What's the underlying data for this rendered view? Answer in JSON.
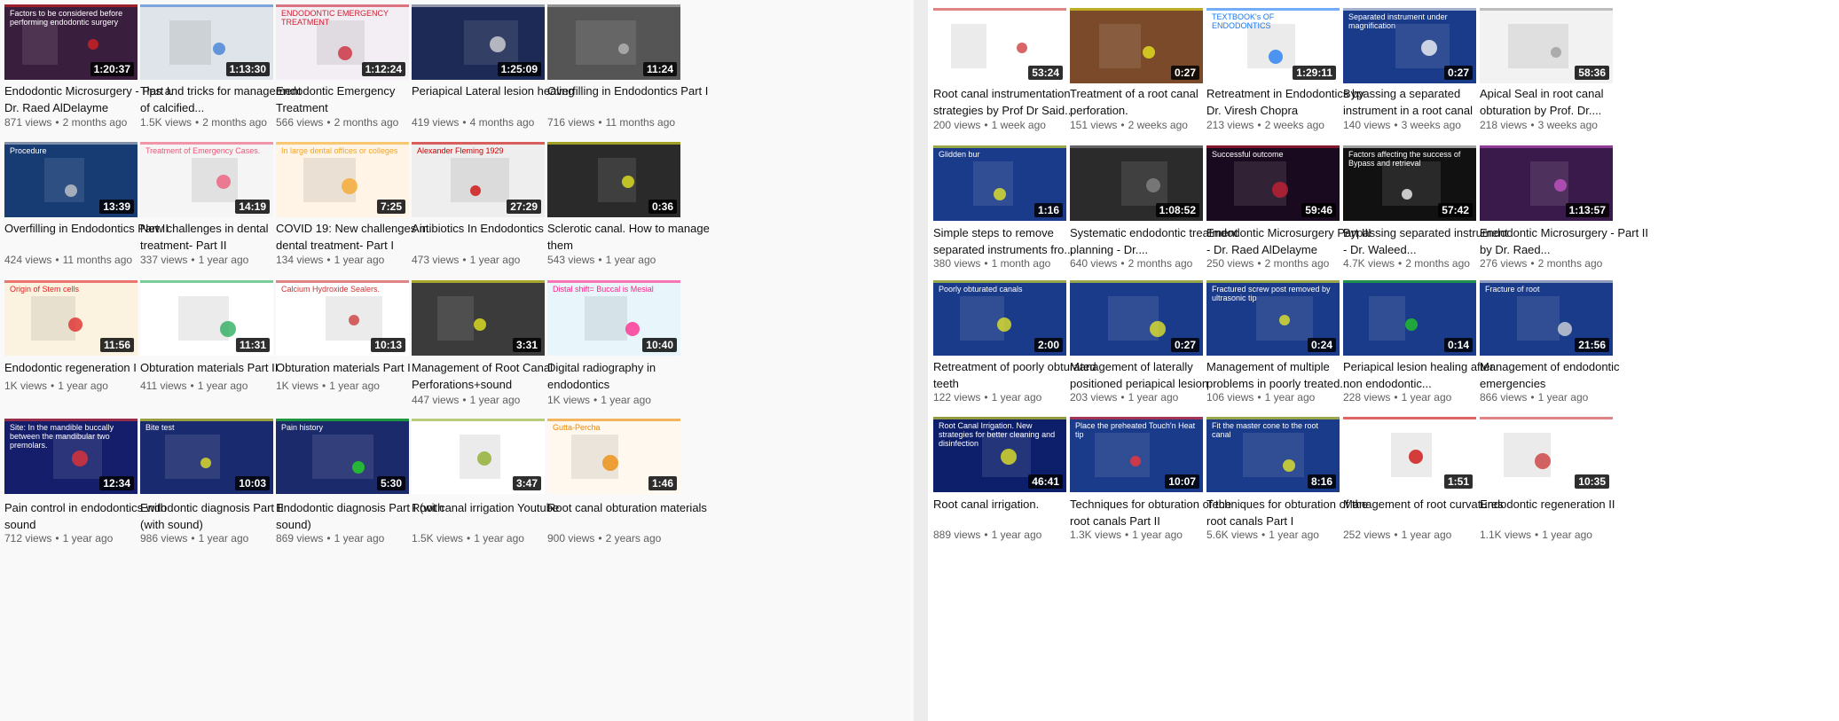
{
  "left": {
    "videos": [
      {
        "title": "Endodontic Microsurgery - Part I. Dr. Raed AlDelayme",
        "views": "871 views",
        "age": "2 months ago",
        "duration": "1:20:37",
        "bg": "#3a1e3e",
        "accent": "#d22",
        "thumb_text": "Factors to be considered before performing endodontic surgery"
      },
      {
        "title": "Tips and tricks for management of calcified...",
        "views": "1.5K views",
        "age": "2 months ago",
        "duration": "1:13:30",
        "bg": "#dfe4ea",
        "accent": "#3a7bd5",
        "thumb_text": ""
      },
      {
        "title": "Endodontic Emergency Treatment",
        "views": "566 views",
        "age": "2 months ago",
        "duration": "1:12:24",
        "bg": "#f3eef3",
        "accent": "#c23",
        "thumb_text": "ENDODONTIC EMERGENCY TREATMENT"
      },
      {
        "title": "Periapical Lateral lesion healing",
        "views": "419 views",
        "age": "4 months ago",
        "duration": "1:25:09",
        "bg": "#1d2a55",
        "accent": "#ddd",
        "thumb_text": ""
      },
      {
        "title": "Overfilling in Endodontics Part I",
        "views": "716 views",
        "age": "11 months ago",
        "duration": "11:24",
        "bg": "#555",
        "accent": "#bbb",
        "thumb_text": ""
      },
      {
        "title": "Overfilling in Endodontics Part II",
        "views": "424 views",
        "age": "11 months ago",
        "duration": "13:39",
        "bg": "#173b73",
        "accent": "#ccc",
        "thumb_text": "Procedure"
      },
      {
        "title": "New challenges in dental treatment- Part II",
        "views": "337 views",
        "age": "1 year ago",
        "duration": "14:19",
        "bg": "#f5f5f5",
        "accent": "#e57",
        "thumb_text": "Treatment of Emergency Cases."
      },
      {
        "title": "COVID 19: New challenges in dental treatment- Part I",
        "views": "134 views",
        "age": "1 year ago",
        "duration": "7:25",
        "bg": "#fff4e6",
        "accent": "#f5a623",
        "thumb_text": "In large dental offices or colleges"
      },
      {
        "title": "Antibiotics In Endodontics",
        "views": "473 views",
        "age": "1 year ago",
        "duration": "27:29",
        "bg": "#eeeeee",
        "accent": "#c00",
        "thumb_text": "Alexander Fleming 1929"
      },
      {
        "title": "Sclerotic canal. How to manage them",
        "views": "543 views",
        "age": "1 year ago",
        "duration": "0:36",
        "bg": "#2a2a2a",
        "accent": "#ee2",
        "thumb_text": ""
      },
      {
        "title": "Endodontic regeneration I",
        "views": "1K views",
        "age": "1 year ago",
        "duration": "11:56",
        "bg": "#fbf3e0",
        "accent": "#d22",
        "thumb_text": "Origin of Stem cells"
      },
      {
        "title": "Obturation materials Part II",
        "views": "411 views",
        "age": "1 year ago",
        "duration": "11:31",
        "bg": "#ffffff",
        "accent": "#2a5",
        "thumb_text": ""
      },
      {
        "title": "Obturation materials Part I",
        "views": "1K views",
        "age": "1 year ago",
        "duration": "10:13",
        "bg": "#ffffff",
        "accent": "#c33",
        "thumb_text": "Calcium Hydroxide Sealers."
      },
      {
        "title": "Management of Root Canal Perforations+sound",
        "views": "447 views",
        "age": "1 year ago",
        "duration": "3:31",
        "bg": "#3b3b3b",
        "accent": "#ee2",
        "thumb_text": ""
      },
      {
        "title": "Digital radiography in endodontics",
        "views": "1K views",
        "age": "1 year ago",
        "duration": "10:40",
        "bg": "#e8f6fb",
        "accent": "#f28",
        "thumb_text": "Distal shift= Buccal is Mesial"
      },
      {
        "title": "Pain control in endodontics with sound",
        "views": "712 views",
        "age": "1 year ago",
        "duration": "12:34",
        "bg": "#151e6b",
        "accent": "#e33",
        "thumb_text": "Site: In the mandible buccally between the mandibular two premolars."
      },
      {
        "title": "Endodontic diagnosis Part II (with sound)",
        "views": "986 views",
        "age": "1 year ago",
        "duration": "10:03",
        "bg": "#1a2a6e",
        "accent": "#ee2",
        "thumb_text": "Bite test"
      },
      {
        "title": "Endodontic diagnosis Part I (with sound)",
        "views": "869 views",
        "age": "1 year ago",
        "duration": "5:30",
        "bg": "#1b2a6b",
        "accent": "#2d2",
        "thumb_text": "Pain history"
      },
      {
        "title": "Root canal irrigation Youtube",
        "views": "1.5K views",
        "age": "1 year ago",
        "duration": "3:47",
        "bg": "#ffffff",
        "accent": "#8a2",
        "thumb_text": ""
      },
      {
        "title": "Root canal obturation materials",
        "views": "900 views",
        "age": "2 years ago",
        "duration": "1:46",
        "bg": "#fff8ee",
        "accent": "#e80",
        "thumb_text": "Gutta-Percha"
      }
    ]
  },
  "right": {
    "videos": [
      {
        "title": "Root canal instrumentation strategies by Prof Dr Said...",
        "views": "200 views",
        "age": "1 week ago",
        "duration": "53:24",
        "bg": "#ffffff",
        "accent": "#c33",
        "thumb_text": ""
      },
      {
        "title": "Treatment of a root canal perforation.",
        "views": "151 views",
        "age": "2 weeks ago",
        "duration": "0:27",
        "bg": "#7a4a2a",
        "accent": "#ee2",
        "thumb_text": ""
      },
      {
        "title": "Retreatment in Endodontics by Dr. Viresh Chopra",
        "views": "213 views",
        "age": "2 weeks ago",
        "duration": "1:29:11",
        "bg": "#ffffff",
        "accent": "#1877f2",
        "thumb_text": "TEXTBOOK's OF ENDODONTICS"
      },
      {
        "title": "Bypassing a separated instrument in a root canal",
        "views": "140 views",
        "age": "3 weeks ago",
        "duration": "0:27",
        "bg": "#1a3a8a",
        "accent": "#fff",
        "thumb_text": "Separated instrument under magnification"
      },
      {
        "title": "Apical Seal in root canal obturation by Prof. Dr....",
        "views": "218 views",
        "age": "3 weeks ago",
        "duration": "58:36",
        "bg": "#f2f2f2",
        "accent": "#999",
        "thumb_text": ""
      },
      {
        "title": "Simple steps to remove separated instruments fro...",
        "views": "380 views",
        "age": "1 month ago",
        "duration": "1:16",
        "bg": "#1a3a8a",
        "accent": "#ee2",
        "thumb_text": "Glidden bur"
      },
      {
        "title": "Systematic endodontic treatment planning - Dr....",
        "views": "640 views",
        "age": "2 months ago",
        "duration": "1:08:52",
        "bg": "#2b2b2b",
        "accent": "#888",
        "thumb_text": ""
      },
      {
        "title": "Endodontic Microsurgery Part III - Dr. Raed AlDelayme",
        "views": "250 views",
        "age": "2 months ago",
        "duration": "59:46",
        "bg": "#1a0a20",
        "accent": "#c23",
        "thumb_text": "Successful outcome"
      },
      {
        "title": "Bypassing separated instrument - Dr. Waleed...",
        "views": "4.7K views",
        "age": "2 months ago",
        "duration": "57:42",
        "bg": "#111111",
        "accent": "#fff",
        "thumb_text": "Factors affecting the success of Bypass and retrieval"
      },
      {
        "title": "Endodontic Microsurgery - Part II by Dr. Raed...",
        "views": "276 views",
        "age": "2 months ago",
        "duration": "1:13:57",
        "bg": "#3a1a4a",
        "accent": "#c5c",
        "thumb_text": ""
      },
      {
        "title": "Retreatment of poorly obturated teeth",
        "views": "122 views",
        "age": "1 year ago",
        "duration": "2:00",
        "bg": "#1a3a8a",
        "accent": "#ee2",
        "thumb_text": "Poorly obturated canals"
      },
      {
        "title": "Management of laterally positioned periapical lesion",
        "views": "203 views",
        "age": "1 year ago",
        "duration": "0:27",
        "bg": "#1a3a8a",
        "accent": "#ee2",
        "thumb_text": ""
      },
      {
        "title": "Management of multiple problems in poorly treated...",
        "views": "106 views",
        "age": "1 year ago",
        "duration": "0:24",
        "bg": "#1a3a8a",
        "accent": "#ee2",
        "thumb_text": "Fractured screw post removed by ultrasonic tip"
      },
      {
        "title": "Periapical lesion healing after non endodontic...",
        "views": "228 views",
        "age": "1 year ago",
        "duration": "0:14",
        "bg": "#1a3a8a",
        "accent": "#2c2",
        "thumb_text": ""
      },
      {
        "title": "Management of endodontic emergencies",
        "views": "866 views",
        "age": "1 year ago",
        "duration": "21:56",
        "bg": "#1a3a8a",
        "accent": "#ddd",
        "thumb_text": "Fracture of root"
      },
      {
        "title": "Root canal irrigation.",
        "views": "889 views",
        "age": "1 year ago",
        "duration": "46:41",
        "bg": "#0d1f6b",
        "accent": "#ee2",
        "thumb_text": "Root Canal Irrigation. New strategies for better cleaning and disinfection"
      },
      {
        "title": "Techniques for obturation of the root canals Part II",
        "views": "1.3K views",
        "age": "1 year ago",
        "duration": "10:07",
        "bg": "#1a3a8a",
        "accent": "#f33",
        "thumb_text": "Place the preheated Touch'n Heat tip"
      },
      {
        "title": "Techniques for obturation of the root canals Part I",
        "views": "5.6K views",
        "age": "1 year ago",
        "duration": "8:16",
        "bg": "#1a3a8a",
        "accent": "#ee2",
        "thumb_text": "Fit the master cone to the root canal"
      },
      {
        "title": "Management of root curvatures",
        "views": "252 views",
        "age": "1 year ago",
        "duration": "1:51",
        "bg": "#ffffff",
        "accent": "#c00",
        "thumb_text": ""
      },
      {
        "title": "Endodontic regeneration II",
        "views": "1.1K views",
        "age": "1 year ago",
        "duration": "10:35",
        "bg": "#ffffff",
        "accent": "#c33",
        "thumb_text": ""
      }
    ]
  }
}
